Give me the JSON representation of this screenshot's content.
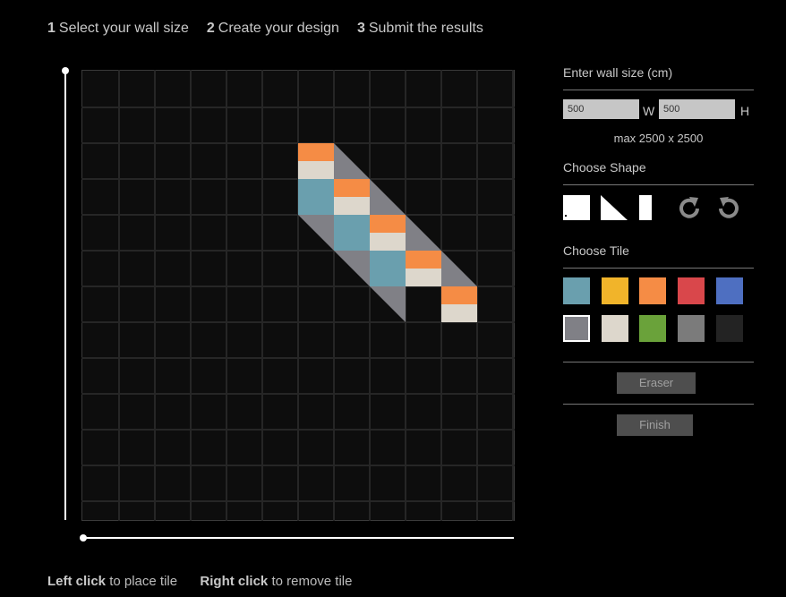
{
  "steps": [
    {
      "num": "1",
      "label": "Select your wall size"
    },
    {
      "num": "2",
      "label": "Create your design"
    },
    {
      "num": "3",
      "label": "Submit the results"
    }
  ],
  "panel": {
    "wall_size_title": "Enter wall size (cm)",
    "width_value": "500",
    "width_unit": "W",
    "height_value": "500",
    "height_unit": "H",
    "max_text": "max 2500 x 2500",
    "shape_title": "Choose Shape",
    "shapes": [
      "square-shape-icon",
      "triangle-shape-icon",
      "half-tile-shape-icon"
    ],
    "rotate_icons": [
      "rotate-right-icon",
      "rotate-left-icon"
    ],
    "tile_title": "Choose Tile",
    "tiles": [
      {
        "color": "#6a9fae"
      },
      {
        "color": "#f1b42a"
      },
      {
        "color": "#f58c45"
      },
      {
        "color": "#d9474b"
      },
      {
        "color": "#4e6fc1"
      },
      {
        "color": "#808086",
        "selected": true
      },
      {
        "color": "#ddd7cc"
      },
      {
        "color": "#6aa23a"
      },
      {
        "color": "#7b7b7b"
      },
      {
        "color": "#232323"
      }
    ],
    "eraser_label": "Eraser",
    "finish_label": "Finish"
  },
  "help": {
    "left_bold": "Left click",
    "left_text": " to place tile",
    "right_bold": "Right click",
    "right_text": " to remove tile"
  },
  "design": {
    "grid_cols": 12,
    "grid_rows": 12,
    "colors": {
      "orange": "#f58c45",
      "cream": "#ddd7cc",
      "blue": "#6a9fae",
      "grey": "#808086"
    },
    "tiles": [
      {
        "col": 6,
        "row": 2,
        "kind": "top-half",
        "color": "orange"
      },
      {
        "col": 6,
        "row": 2,
        "kind": "bottom-half",
        "color": "cream"
      },
      {
        "col": 7,
        "row": 2,
        "kind": "tri-bl",
        "color": "grey"
      },
      {
        "col": 6,
        "row": 3,
        "kind": "full",
        "color": "blue"
      },
      {
        "col": 7,
        "row": 3,
        "kind": "top-half",
        "color": "orange"
      },
      {
        "col": 7,
        "row": 3,
        "kind": "bottom-half",
        "color": "cream"
      },
      {
        "col": 8,
        "row": 3,
        "kind": "tri-bl",
        "color": "grey"
      },
      {
        "col": 6,
        "row": 4,
        "kind": "tri-tr",
        "color": "grey"
      },
      {
        "col": 7,
        "row": 4,
        "kind": "full",
        "color": "blue"
      },
      {
        "col": 8,
        "row": 4,
        "kind": "top-half",
        "color": "orange"
      },
      {
        "col": 8,
        "row": 4,
        "kind": "bottom-half",
        "color": "cream"
      },
      {
        "col": 9,
        "row": 4,
        "kind": "tri-bl",
        "color": "grey"
      },
      {
        "col": 7,
        "row": 5,
        "kind": "tri-tr",
        "color": "grey"
      },
      {
        "col": 8,
        "row": 5,
        "kind": "full",
        "color": "blue"
      },
      {
        "col": 9,
        "row": 5,
        "kind": "top-half",
        "color": "orange"
      },
      {
        "col": 9,
        "row": 5,
        "kind": "bottom-half",
        "color": "cream"
      },
      {
        "col": 10,
        "row": 5,
        "kind": "tri-bl",
        "color": "grey"
      },
      {
        "col": 8,
        "row": 6,
        "kind": "tri-tr",
        "color": "grey"
      },
      {
        "col": 10,
        "row": 6,
        "kind": "top-half",
        "color": "orange"
      },
      {
        "col": 10,
        "row": 6,
        "kind": "bottom-half",
        "color": "cream"
      }
    ]
  }
}
